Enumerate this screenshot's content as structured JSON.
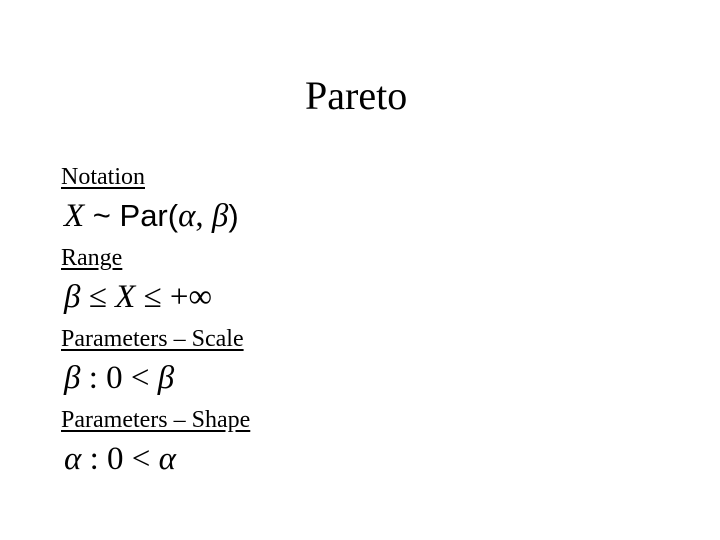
{
  "slide": {
    "title": "Pareto",
    "sections": [
      {
        "label": "Notation",
        "formula": {
          "var": "X",
          "op": " ~ ",
          "fn": "Par",
          "open": "(",
          "a": "α",
          "comma": ", ",
          "b": "β",
          "close": ")"
        }
      },
      {
        "label": "Range",
        "formula": {
          "lhs": "β",
          "op1": " ≤ ",
          "mid": "X",
          "op2": " ≤ ",
          "rhs": "+∞"
        }
      },
      {
        "label": "Parameters – Scale",
        "formula": {
          "param": "β",
          "colon": " : ",
          "zero": "0",
          "op": " < ",
          "rhs": "β"
        }
      },
      {
        "label": "Parameters – Shape",
        "formula": {
          "param": "α",
          "colon": " : ",
          "zero": "0",
          "op": " < ",
          "rhs": "α"
        }
      }
    ]
  }
}
